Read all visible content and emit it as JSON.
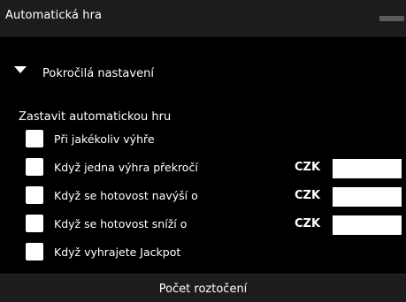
{
  "window": {
    "title": "Automatická hra"
  },
  "advanced": {
    "label": "Pokročilá nastavení"
  },
  "stop": {
    "label": "Zastavit automatickou hru",
    "options": [
      {
        "label": "Při jakékoliv výhře"
      },
      {
        "label": "Když jedna výhra překročí",
        "currency": "CZK",
        "value": ""
      },
      {
        "label": "Když se hotovost navýší o",
        "currency": "CZK",
        "value": ""
      },
      {
        "label": "Když se hotovost sníží o",
        "currency": "CZK",
        "value": ""
      },
      {
        "label": "Když vyhrajete Jackpot"
      }
    ]
  },
  "footer": {
    "label": "Počet roztočení"
  },
  "colors": {
    "background": "#000000",
    "titlebar": "#1c1c1c",
    "text": "#ffffff"
  }
}
